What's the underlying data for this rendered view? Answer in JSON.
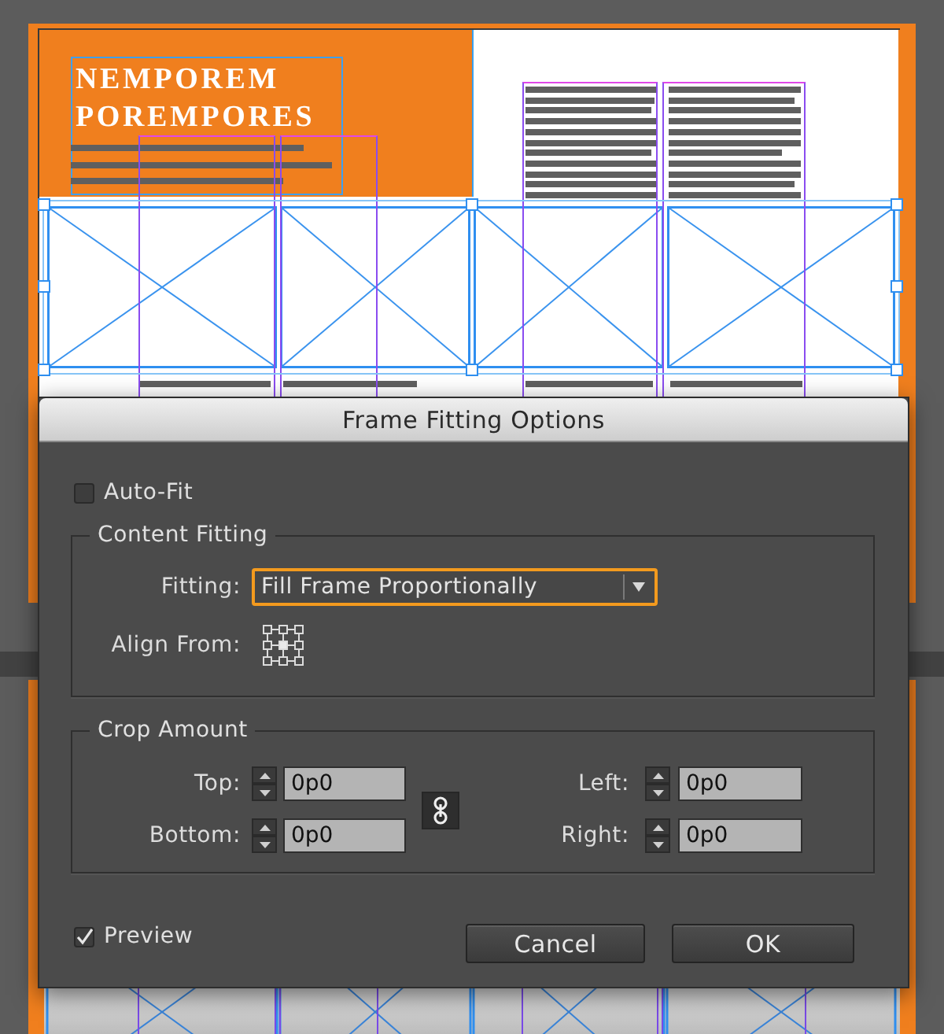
{
  "document": {
    "headline_lines": [
      "NEMPOREM",
      "POREMPORES"
    ]
  },
  "dialog": {
    "title": "Frame Fitting Options",
    "auto_fit": {
      "label": "Auto-Fit",
      "checked": false
    },
    "content_fitting": {
      "legend": "Content Fitting",
      "fitting": {
        "label": "Fitting:",
        "value": "Fill Frame Proportionally",
        "focused": true
      },
      "align_from": {
        "label": "Align From:",
        "points": [
          {
            "selected": false
          },
          {
            "selected": false
          },
          {
            "selected": false
          },
          {
            "selected": false
          },
          {
            "selected": true
          },
          {
            "selected": false
          },
          {
            "selected": false
          },
          {
            "selected": false
          },
          {
            "selected": false
          }
        ]
      }
    },
    "crop_amount": {
      "legend": "Crop Amount",
      "left_fields": [
        {
          "label": "Top:",
          "value": "0p0"
        },
        {
          "label": "Bottom:",
          "value": "0p0"
        }
      ],
      "right_fields": [
        {
          "label": "Left:",
          "value": "0p0"
        },
        {
          "label": "Right:",
          "value": "0p0"
        }
      ]
    },
    "preview": {
      "label": "Preview",
      "checked": true
    },
    "buttons": [
      "Cancel",
      "OK"
    ]
  }
}
